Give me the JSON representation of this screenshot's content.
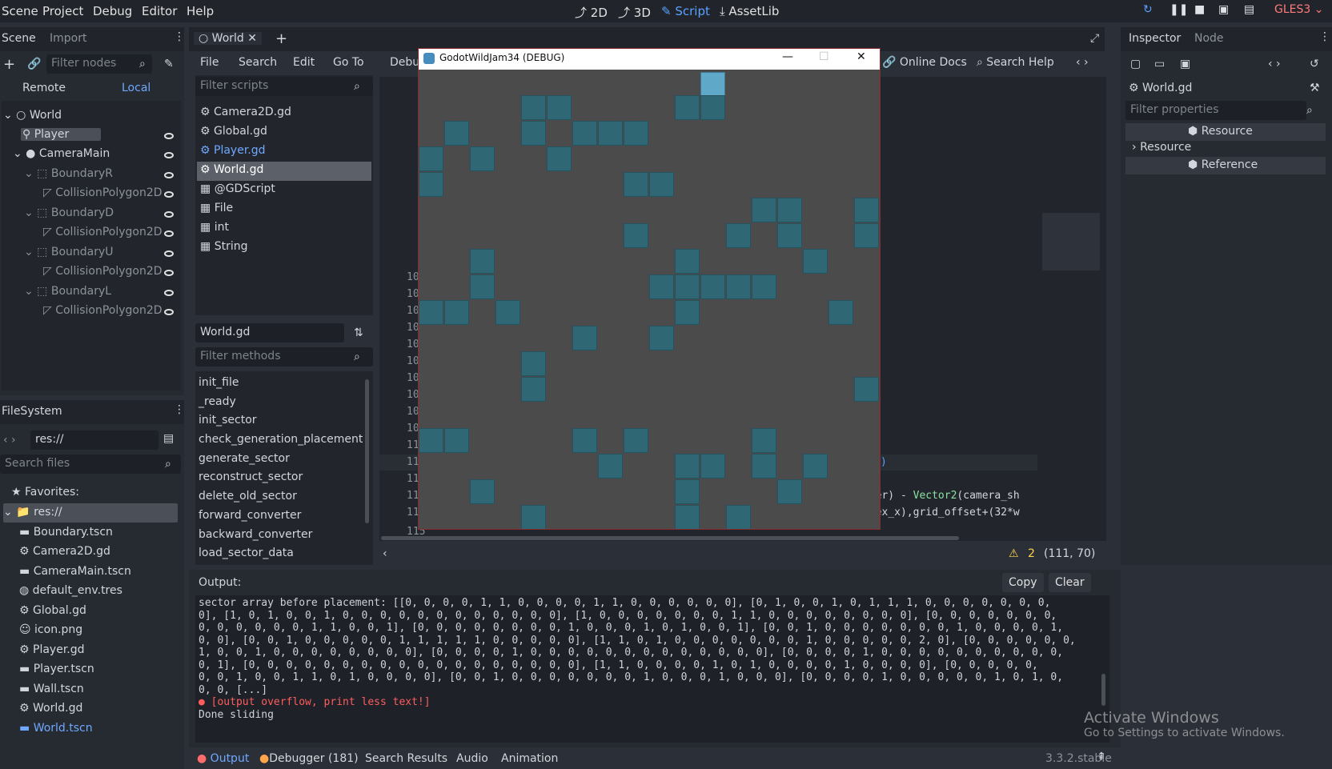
{
  "menu": {
    "scene": "Scene",
    "project": "Project",
    "debug": "Debug",
    "editor": "Editor",
    "help": "Help"
  },
  "workspaces": {
    "w2d": "2D",
    "w3d": "3D",
    "script": "Script",
    "assetlib": "AssetLib"
  },
  "renderer": "GLES3",
  "scene_dock": {
    "tab_scene": "Scene",
    "tab_import": "Import",
    "filter_placeholder": "Filter nodes",
    "remote": "Remote",
    "local": "Local",
    "tree": [
      {
        "label": "World"
      },
      {
        "label": "Player"
      },
      {
        "label": "CameraMain"
      },
      {
        "label": "BoundaryR"
      },
      {
        "label": "CollisionPolygon2D"
      },
      {
        "label": "BoundaryD"
      },
      {
        "label": "CollisionPolygon2D"
      },
      {
        "label": "BoundaryU"
      },
      {
        "label": "CollisionPolygon2D"
      },
      {
        "label": "BoundaryL"
      },
      {
        "label": "CollisionPolygon2D"
      }
    ]
  },
  "filesystem": {
    "title": "FileSystem",
    "path": "res://",
    "search_placeholder": "Search files",
    "favorites": "Favorites:",
    "root": "res://",
    "files": [
      "Boundary.tscn",
      "Camera2D.gd",
      "CameraMain.tscn",
      "default_env.tres",
      "Global.gd",
      "icon.png",
      "Player.gd",
      "Player.tscn",
      "Wall.tscn",
      "World.gd",
      "World.tscn"
    ]
  },
  "editor_tab": {
    "label": "World"
  },
  "script_menu": {
    "file": "File",
    "search": "Search",
    "edit": "Edit",
    "goto": "Go To",
    "debug": "Debug",
    "online_docs": "Online Docs",
    "search_help": "Search Help"
  },
  "scripts": {
    "filter_placeholder": "Filter scripts",
    "list": [
      "Camera2D.gd",
      "Global.gd",
      "Player.gd",
      "World.gd",
      "@GDScript",
      "File",
      "int",
      "String"
    ],
    "current": "World.gd",
    "methods_placeholder": "Filter methods",
    "methods": [
      "init_file",
      "_ready",
      "init_sector",
      "check_generation_placement",
      "generate_sector",
      "reconstruct_sector",
      "delete_old_sector",
      "forward_converter",
      "backward_converter",
      "load_sector_data"
    ]
  },
  "code": {
    "line_numbers": [
      "10",
      "10",
      "10",
      "10",
      "10",
      "10",
      "10",
      "10",
      "10",
      "10",
      "11",
      "11",
      "11",
      "11",
      "11",
      "115"
    ],
    "frag1": ")",
    "frag2": "eter) - ",
    "frag2b": "Vector2",
    "frag2c": "(camera_sh",
    "frag3": "ndex_x),grid_offset+(32*w",
    "warnings": "2",
    "cursor": "(111, 70)"
  },
  "game_window": {
    "title": "GodotWildJam34 (DEBUG)"
  },
  "inspector": {
    "tab_inspector": "Inspector",
    "tab_node": "Node",
    "object": "World.gd",
    "filter_placeholder": "Filter properties",
    "section": "Resource",
    "sub": "Resource",
    "reference": "Reference"
  },
  "output": {
    "label": "Output:",
    "copy": "Copy",
    "clear": "Clear",
    "lines": [
      "sector array before placement: [[0, 0, 0, 0, 1, 1, 0, 0, 0, 0, 1, 1, 0, 0, 0, 0, 0, 0], [0, 1, 0, 0, 1, 0, 1, 1, 1, 0, 0, 0, 0, 0, 0, 0,",
      "0], [1, 0, 1, 0, 0, 1, 0, 0, 0, 0, 0, 0, 0, 0, 0, 0, 0, 0], [1, 0, 0, 0, 0, 0, 0, 0, 1, 1, 0, 0, 0, 0, 0, 0, 0, 0], [0, 0, 0, 0, 0, 0, 0,",
      "0, 0, 0, 0, 0, 0, 1, 1, 0, 0, 1], [0, 0, 0, 0, 0, 0, 0, 0, 1, 0, 0, 0, 1, 0, 1, 0, 0, 1], [0, 0, 1, 0, 0, 0, 0, 0, 0, 0, 1, 0, 0, 0, 0, 1,",
      "0, 0], [0, 0, 1, 0, 0, 0, 0, 0, 1, 1, 1, 1, 1, 0, 0, 0, 0, 0], [1, 1, 0, 1, 0, 0, 0, 0, 0, 0, 0, 1, 0, 0, 0, 0, 0, 2, 0], [0, 0, 0, 0, 0, 0,",
      "1, 0, 0, 1, 0, 0, 0, 0, 0, 0, 0, 0], [0, 0, 0, 0, 1, 0, 0, 0, 0, 0, 0, 0, 0, 0, 0, 0, 0, 0], [0, 0, 0, 0, 1, 0, 0, 0, 0, 0, 0, 0, 0, 0, 0,",
      "0, 1], [0, 0, 0, 0, 0, 0, 0, 0, 0, 0, 0, 0, 0, 0, 0, 0, 0, 0], [1, 1, 0, 0, 0, 0, 1, 0, 1, 0, 0, 0, 0, 1, 0, 0, 0, 0], [0, 0, 0, 0, 0,",
      "0, 0, 1, 0, 0, 1, 1, 0, 1, 0, 0, 0, 0], [0, 0, 1, 0, 0, 0, 0, 0, 0, 0, 1, 0, 0, 0, 1, 0, 0, 0], [0, 0, 0, 0, 1, 0, 0, 0, 0, 0, 1, 0, 1, 0,",
      "0, 0, [...]"
    ],
    "error": "[output overflow, print less text!]",
    "last": "Done sliding"
  },
  "bottom_tabs": {
    "output": "Output",
    "debugger": "Debugger (181)",
    "search": "Search Results",
    "audio": "Audio",
    "animation": "Animation"
  },
  "version": "3.3.2.stable",
  "watermark": {
    "title": "Activate Windows",
    "sub": "Go to Settings to activate Windows."
  },
  "colors": {
    "accent": "#5aa0ff",
    "tile": "#2f6775",
    "error": "#ff5d5d"
  }
}
